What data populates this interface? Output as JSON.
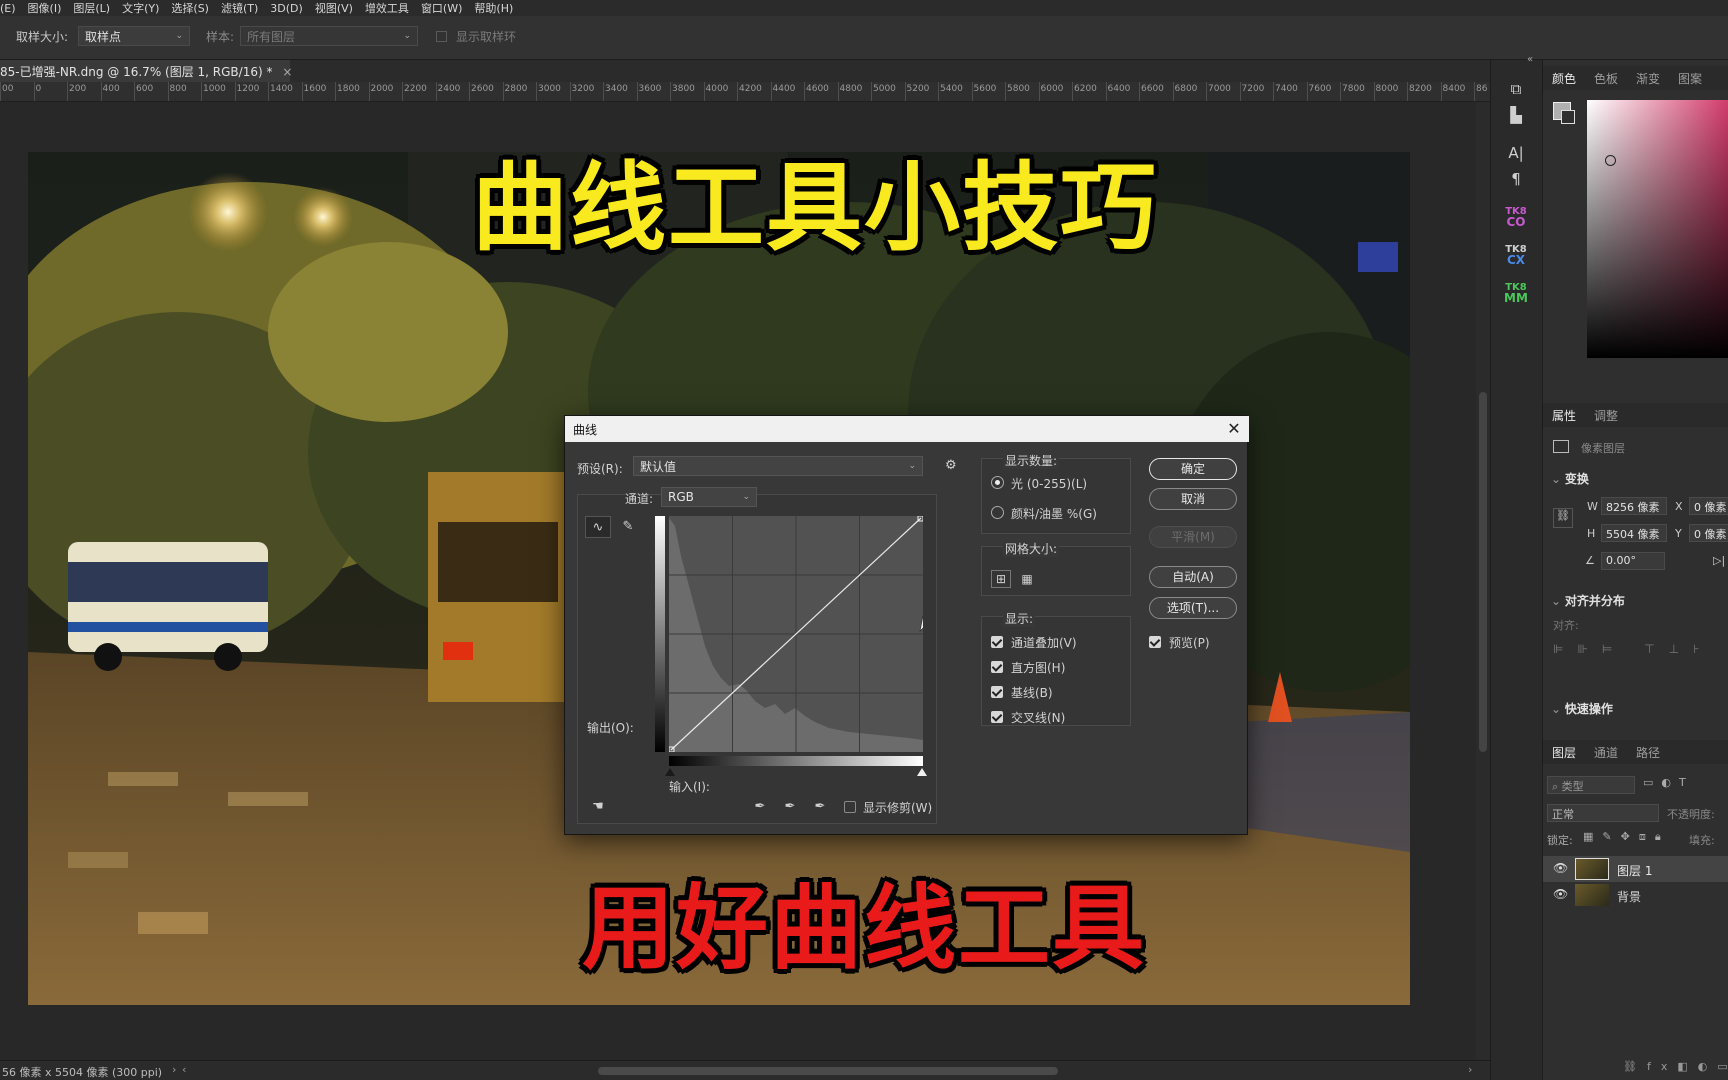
{
  "menubar": {
    "items": [
      "(E)",
      "图像(I)",
      "图层(L)",
      "文字(Y)",
      "选择(S)",
      "滤镜(T)",
      "3D(D)",
      "视图(V)",
      "增效工具",
      "窗口(W)",
      "帮助(H)"
    ]
  },
  "options": {
    "sample_size_label": "取样大小:",
    "sample_size_value": "取样点",
    "sample_label": "样本:",
    "sample_value": "所有图层",
    "show_ring_label": "显示取样环"
  },
  "document_tab": {
    "title": "85-已增强-NR.dng @ 16.7% (图层 1, RGB/16) *",
    "close": "×"
  },
  "ruler": {
    "ticks": [
      "00",
      "0",
      "200",
      "400",
      "600",
      "800",
      "1000",
      "1200",
      "1400",
      "1600",
      "1800",
      "2000",
      "2200",
      "2400",
      "2600",
      "2800",
      "3000",
      "3200",
      "3400",
      "3600",
      "3800",
      "4000",
      "4200",
      "4400",
      "4600",
      "4800",
      "5000",
      "5200",
      "5400",
      "5600",
      "5800",
      "6000",
      "6200",
      "6400",
      "6600",
      "6800",
      "7000",
      "7200",
      "7400",
      "7600",
      "7800",
      "8000",
      "8200",
      "8400",
      "86"
    ]
  },
  "captions": {
    "top": "曲线工具小技巧",
    "bottom": "用好曲线工具"
  },
  "status": {
    "text": "56 像素 x 5504 像素 (300 ppi)"
  },
  "toolstrip": {
    "tk_labels": [
      {
        "top": "TK8",
        "bottom": "CO"
      },
      {
        "top": "TK8",
        "bottom": "CX"
      },
      {
        "top": "TK8",
        "bottom": "MM"
      }
    ]
  },
  "panels": {
    "color_tabs": [
      "颜色",
      "色板",
      "渐变",
      "图案"
    ],
    "properties_tabs": [
      "属性",
      "调整"
    ],
    "pixel_layer_label": "像素图层",
    "transform_header": "变换",
    "w_label": "W",
    "w_value": "8256 像素",
    "x_label": "X",
    "x_value": "0 像素",
    "h_label": "H",
    "h_value": "5504 像素",
    "y_label": "Y",
    "y_value": "0 像素",
    "angle_value": "0.00°",
    "align_header": "对齐并分布",
    "align_label": "对齐:",
    "quick_actions_header": "快速操作",
    "layers_tabs": [
      "图层",
      "通道",
      "路径"
    ],
    "kind_filter": "类型",
    "blend_mode": "正常",
    "opacity_label": "不透明度:",
    "lock_label": "锁定:",
    "fill_label": "填充:",
    "layers": [
      {
        "name": "图层 1"
      },
      {
        "name": "背景"
      }
    ]
  },
  "dialog": {
    "title": "曲线",
    "close": "✕",
    "preset_label": "预设(R):",
    "preset_value": "默认值",
    "channel_label": "通道:",
    "channel_value": "RGB",
    "output_label": "输出(O):",
    "input_label": "输入(I):",
    "show_clipping_label": "显示修剪(W)",
    "show_amount_label": "显示数量:",
    "light_label": "光 (0-255)(L)",
    "pigment_label": "颜料/油墨 %(G)",
    "grid_size_label": "网格大小:",
    "show_label": "显示:",
    "channel_overlay_label": "通道叠加(V)",
    "histogram_label": "直方图(H)",
    "baseline_label": "基线(B)",
    "intersection_label": "交叉线(N)",
    "ok_label": "确定",
    "cancel_label": "取消",
    "smooth_label": "平滑(M)",
    "auto_label": "自动(A)",
    "options_label": "选项(T)...",
    "preview_label": "预览(P)"
  }
}
